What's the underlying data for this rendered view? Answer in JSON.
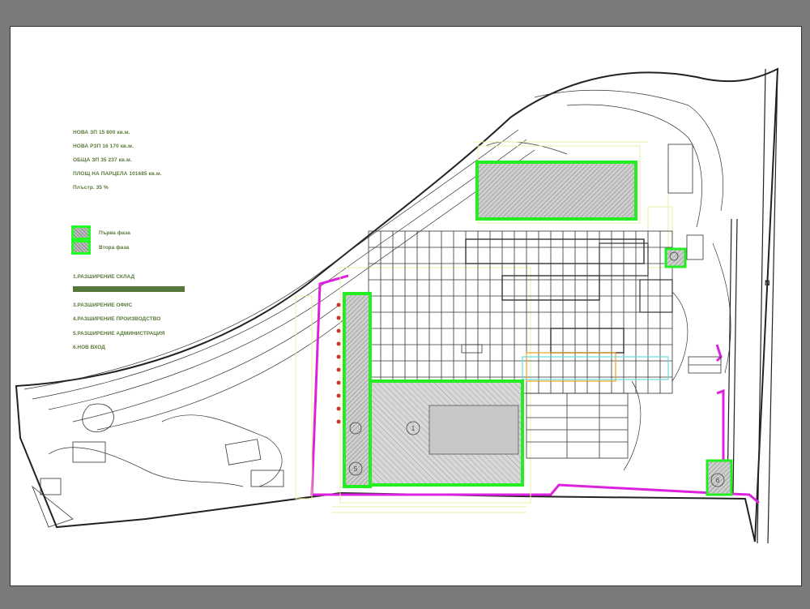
{
  "info_lines": [
    "НОВА ЗП 15 800 кв.м.",
    "НОВА РЗП 16 170 кв.м.",
    "ОБЩА ЗП 35 237 кв.м.",
    "ПЛОЩ НА ПАРЦЕЛА 101685 кв.м.",
    "Плъстр. 35 %"
  ],
  "legend": {
    "phase1": "Първа фаза",
    "phase2": "Втора фаза"
  },
  "expansions": [
    "1.РАЗШИРЕНИЕ СКЛАД",
    "3.РАЗШИРЕНИЕ ОФИС",
    "4.РАЗШИРЕНИЕ ПРОИЗВОДСТВО",
    "5.РАЗШИРЕНИЕ АДМИНИСТРАЦИЯ",
    "6.НОВ ВХОД"
  ],
  "markers": [
    "1",
    "5",
    "6"
  ],
  "colors": {
    "phase_outline": "#22ee22",
    "road": "#dd22dd",
    "grid": "#333333",
    "bar": "#56763a"
  }
}
